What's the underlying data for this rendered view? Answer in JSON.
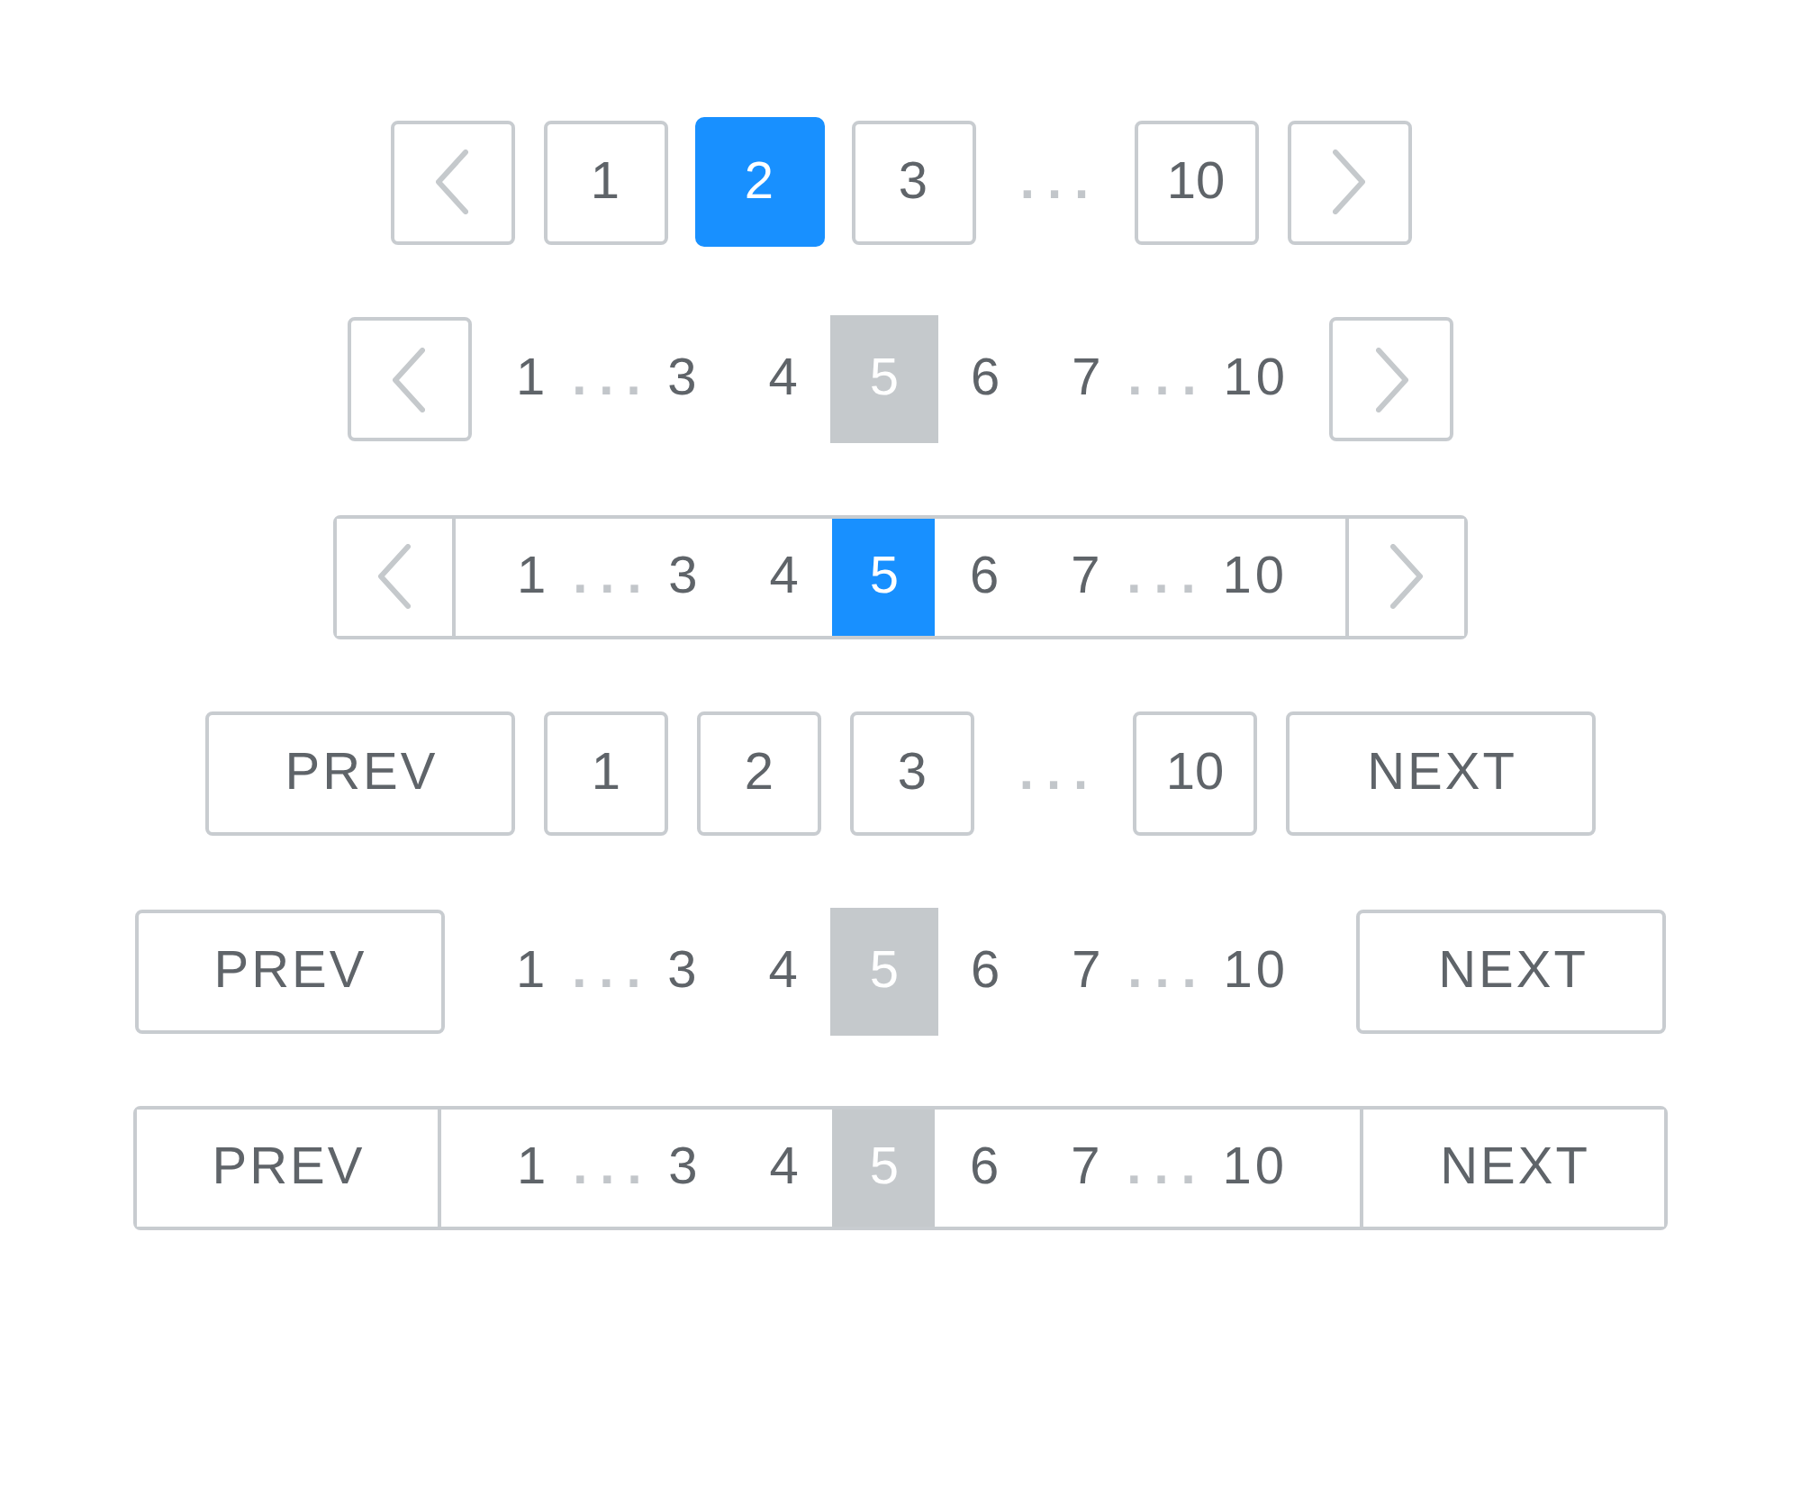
{
  "paginations": [
    {
      "kind": "boxed",
      "color": "#1890ff",
      "prev": {
        "kind": "arrow"
      },
      "next": {
        "kind": "arrow"
      },
      "items": [
        {
          "kind": "page",
          "label": "1",
          "selected": false
        },
        {
          "kind": "page",
          "label": "2",
          "selected": true
        },
        {
          "kind": "page",
          "label": "3",
          "selected": false
        },
        {
          "kind": "ellipsis",
          "label": "..."
        },
        {
          "kind": "page",
          "label": "10",
          "selected": false
        }
      ]
    },
    {
      "kind": "plain",
      "color": "#c5c9cc",
      "prev": {
        "kind": "arrow"
      },
      "next": {
        "kind": "arrow"
      },
      "items": [
        {
          "kind": "page",
          "label": "1",
          "selected": false
        },
        {
          "kind": "ellipsis",
          "label": "..."
        },
        {
          "kind": "page",
          "label": "3",
          "selected": false
        },
        {
          "kind": "page",
          "label": "4",
          "selected": false
        },
        {
          "kind": "page",
          "label": "5",
          "selected": true
        },
        {
          "kind": "page",
          "label": "6",
          "selected": false
        },
        {
          "kind": "page",
          "label": "7",
          "selected": false
        },
        {
          "kind": "ellipsis",
          "label": "..."
        },
        {
          "kind": "page",
          "label": "10",
          "selected": false
        }
      ]
    },
    {
      "kind": "joined",
      "color": "#1890ff",
      "prev": {
        "kind": "arrow"
      },
      "next": {
        "kind": "arrow"
      },
      "items": [
        {
          "kind": "page",
          "label": "1",
          "selected": false
        },
        {
          "kind": "ellipsis",
          "label": "..."
        },
        {
          "kind": "page",
          "label": "3",
          "selected": false
        },
        {
          "kind": "page",
          "label": "4",
          "selected": false
        },
        {
          "kind": "page",
          "label": "5",
          "selected": true
        },
        {
          "kind": "page",
          "label": "6",
          "selected": false
        },
        {
          "kind": "page",
          "label": "7",
          "selected": false
        },
        {
          "kind": "ellipsis",
          "label": "..."
        },
        {
          "kind": "page",
          "label": "10",
          "selected": false
        }
      ]
    },
    {
      "kind": "boxed",
      "prev": {
        "kind": "text",
        "label": "PREV"
      },
      "next": {
        "kind": "text",
        "label": "NEXT"
      },
      "items": [
        {
          "kind": "page",
          "label": "1",
          "selected": false
        },
        {
          "kind": "page",
          "label": "2",
          "selected": false
        },
        {
          "kind": "page",
          "label": "3",
          "selected": false
        },
        {
          "kind": "ellipsis",
          "label": "..."
        },
        {
          "kind": "page",
          "label": "10",
          "selected": false
        }
      ]
    },
    {
      "kind": "plain",
      "color": "#c5c9cc",
      "prev": {
        "kind": "text",
        "label": "PREV"
      },
      "next": {
        "kind": "text",
        "label": "NEXT"
      },
      "items": [
        {
          "kind": "page",
          "label": "1",
          "selected": false
        },
        {
          "kind": "ellipsis",
          "label": "..."
        },
        {
          "kind": "page",
          "label": "3",
          "selected": false
        },
        {
          "kind": "page",
          "label": "4",
          "selected": false
        },
        {
          "kind": "page",
          "label": "5",
          "selected": true
        },
        {
          "kind": "page",
          "label": "6",
          "selected": false
        },
        {
          "kind": "page",
          "label": "7",
          "selected": false
        },
        {
          "kind": "ellipsis",
          "label": "..."
        },
        {
          "kind": "page",
          "label": "10",
          "selected": false
        }
      ]
    },
    {
      "kind": "joined",
      "color": "#c5c9cc",
      "prev": {
        "kind": "text",
        "label": "PREV"
      },
      "next": {
        "kind": "text",
        "label": "NEXT"
      },
      "items": [
        {
          "kind": "page",
          "label": "1",
          "selected": false
        },
        {
          "kind": "ellipsis",
          "label": "..."
        },
        {
          "kind": "page",
          "label": "3",
          "selected": false
        },
        {
          "kind": "page",
          "label": "4",
          "selected": false
        },
        {
          "kind": "page",
          "label": "5",
          "selected": true
        },
        {
          "kind": "page",
          "label": "6",
          "selected": false
        },
        {
          "kind": "page",
          "label": "7",
          "selected": false
        },
        {
          "kind": "ellipsis",
          "label": "..."
        },
        {
          "kind": "page",
          "label": "10",
          "selected": false
        }
      ]
    }
  ]
}
